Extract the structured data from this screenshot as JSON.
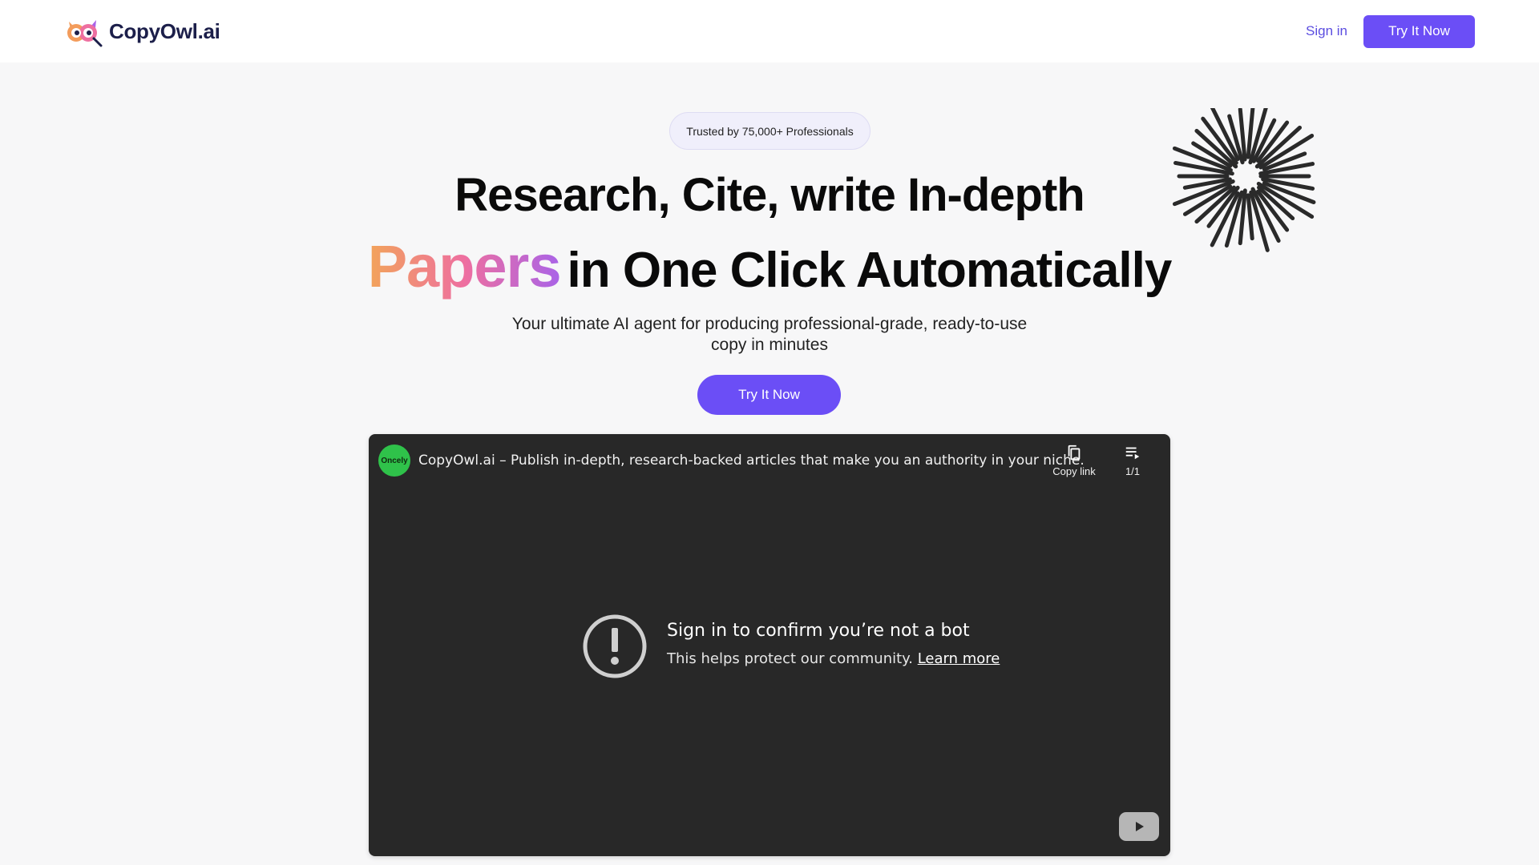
{
  "header": {
    "brand": "CopyOwl.ai",
    "signin_label": "Sign in",
    "cta_label": "Try It Now"
  },
  "hero": {
    "badge": "Trusted by 75,000+ Professionals",
    "headline_line1": "Research, Cite, write In-depth",
    "headline_highlight": "Papers",
    "headline_line2_rest": "in One Click Automatically",
    "subtitle": "Your ultimate AI agent for producing professional-grade, ready-to-use copy in minutes",
    "cta_label": "Try It Now"
  },
  "video": {
    "channel_avatar_text": "Oncely",
    "title": "CopyOwl.ai – Publish in-depth, research-backed articles that make you an authority in your niche.",
    "copy_link_label": "Copy link",
    "playlist_label": "1/1",
    "alert_title": "Sign in to confirm you’re not a bot",
    "alert_desc": "This helps protect our community.",
    "learn_more_label": "Learn more",
    "icons": [
      "copy-icon",
      "playlist-icon",
      "alert-icon",
      "youtube-play-icon"
    ]
  },
  "colors": {
    "accent": "#6b4ef6",
    "brand_text": "#1c1f4a",
    "video_bg": "#282828",
    "gradient": [
      "#f2a45a",
      "#ee6fa0",
      "#a963e8"
    ]
  }
}
